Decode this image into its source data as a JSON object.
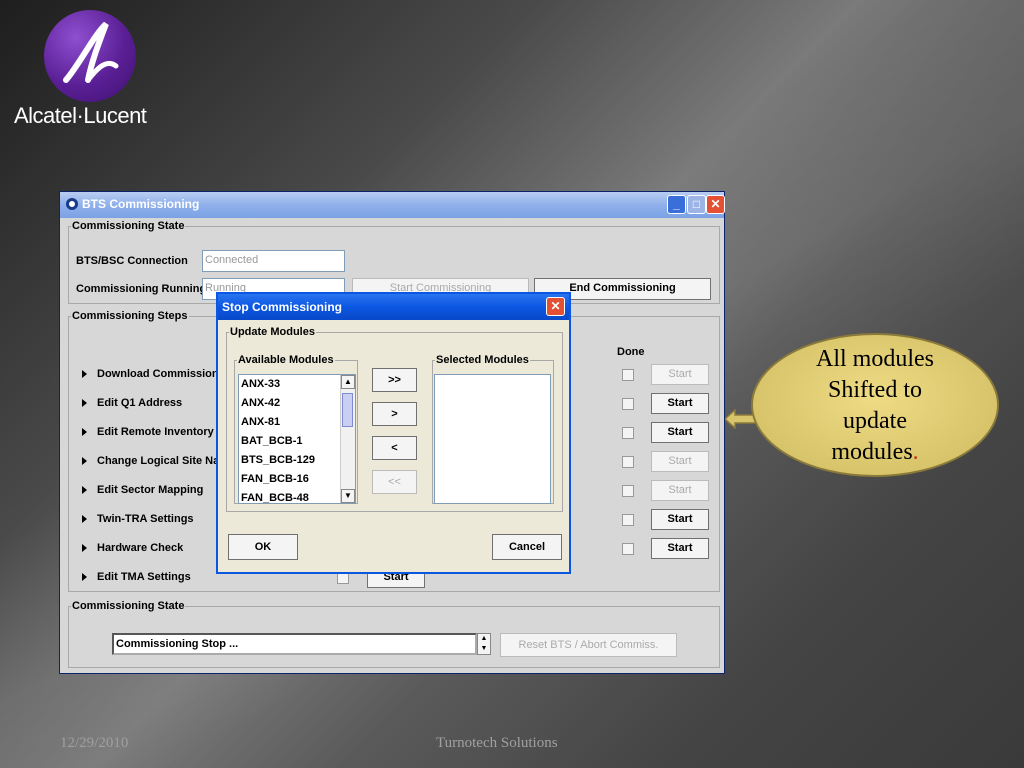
{
  "slide": {
    "logo_text": "Alcatel·Lucent",
    "footer_date": "12/29/2010",
    "footer_company": "Turnotech Solutions"
  },
  "window": {
    "title": "BTS Commissioning",
    "state_group": {
      "legend": "Commissioning State",
      "connection_label": "BTS/BSC Connection",
      "connection_value": "Connected",
      "running_label": "Commissioning Running",
      "running_value": "Running",
      "start_button": "Start Commissioning",
      "end_button": "End Commissioning"
    },
    "steps_group": {
      "legend": "Commissioning Steps",
      "done_header": "Done",
      "steps": [
        {
          "label": "Download Commissioning",
          "button": "Start",
          "enabled": false
        },
        {
          "label": "Edit Q1 Address",
          "button": "Start",
          "enabled": true
        },
        {
          "label": "Edit Remote Inventory",
          "button": "Start",
          "enabled": true
        },
        {
          "label": "Change Logical Site Name",
          "button": "Start",
          "enabled": false
        },
        {
          "label": "Edit Sector Mapping",
          "button": "Start",
          "enabled": false
        },
        {
          "label": "Twin-TRA Settings",
          "button": "Start",
          "enabled": true
        },
        {
          "label": "Hardware Check",
          "button": "Start",
          "enabled": true
        },
        {
          "label": "Edit TMA Settings",
          "button": "Start",
          "enabled": true
        }
      ]
    },
    "bottom_group": {
      "legend": "Commissioning State",
      "status_value": "Commissioning Stop ...",
      "reset_button": "Reset BTS / Abort Commiss."
    }
  },
  "dialog": {
    "title": "Stop Commissioning",
    "group_legend": "Update Modules",
    "available_legend": "Available Modules",
    "selected_legend": "Selected Modules",
    "available_modules": [
      "ANX-33",
      "ANX-42",
      "ANX-81",
      "BAT_BCB-1",
      "BTS_BCB-129",
      "FAN_BCB-16",
      "FAN_BCB-48"
    ],
    "selected_modules": [],
    "move_all_right": ">>",
    "move_right": ">",
    "move_left": "<",
    "move_all_left": "<<",
    "ok_button": "OK",
    "cancel_button": "Cancel"
  },
  "callout": {
    "line1": "All modules",
    "line2": "Shifted to",
    "line3": "update",
    "line4": "modules",
    "dot": ".",
    "dot_color": "#c0392b"
  }
}
